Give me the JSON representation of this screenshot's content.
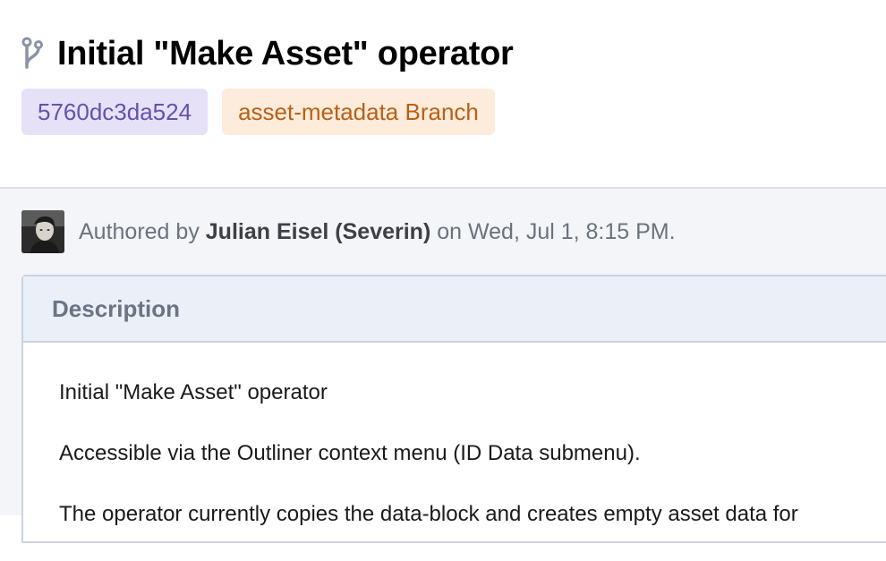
{
  "header": {
    "title": "Initial \"Make Asset\" operator",
    "icon": "branch-icon",
    "tags": {
      "commit": "5760dc3da524",
      "branch": "asset-metadata Branch"
    }
  },
  "author": {
    "prefix": "Authored by",
    "name": "Julian Eisel (Severin)",
    "suffix": "on Wed, Jul 1, 8:15 PM."
  },
  "description": {
    "title": "Description",
    "lines": [
      "Initial \"Make Asset\" operator",
      "Accessible via the Outliner context menu (ID Data submenu).",
      "The operator currently copies the data-block and creates empty asset data for"
    ]
  },
  "colors": {
    "commit_tag_bg": "#e6e1f7",
    "commit_tag_text": "#6750ae",
    "branch_tag_bg": "#fdebdc",
    "branch_tag_text": "#b86114",
    "content_bg": "#f3f5f8",
    "panel_header_bg": "#ebf0f8"
  }
}
